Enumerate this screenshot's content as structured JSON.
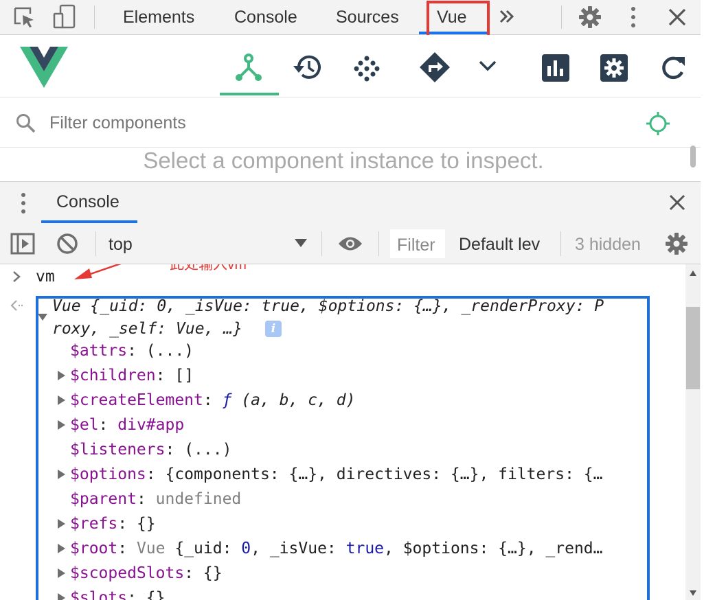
{
  "devtools": {
    "tabs": [
      "Elements",
      "Console",
      "Sources",
      "Vue"
    ],
    "active_tab": "Vue",
    "more_icon": "double-chevron-right-icon",
    "settings_icon": "gear-icon",
    "menu_icon": "vertical-dots-icon",
    "close_icon": "close-icon"
  },
  "vue_panel": {
    "logo": "vue-logo",
    "accent_color": "#42b883",
    "toolbar_icons": [
      "components-icon",
      "timeline-icon",
      "vuex-icon",
      "routing-icon",
      "chevron-down-icon",
      "performance-icon",
      "settings-icon",
      "refresh-icon"
    ],
    "filter_placeholder": "Filter components",
    "empty_message": "Select a component instance to inspect."
  },
  "drawer": {
    "tab_label": "Console",
    "context": "top",
    "filter_placeholder": "Filter",
    "levels": "Default lev",
    "hidden": "3 hidden"
  },
  "console": {
    "input": "vm",
    "annotation": "此处输入vm",
    "annotation_color": "#e53935",
    "highlight_color": "#1e6fd9",
    "summary_line1": "Vue {_uid: 0, _isVue: true, $options: {…}, _renderProxy: P",
    "summary_line2": "roxy, _self: Vue, …}",
    "info_badge": "i",
    "props": [
      {
        "name": "$attrs",
        "value": "(...)",
        "expandable": false,
        "style": "plain"
      },
      {
        "name": "$children",
        "value": "[]",
        "expandable": true,
        "style": "plain"
      },
      {
        "name": "$createElement",
        "value": "ƒ (a, b, c, d)",
        "expandable": true,
        "style": "func"
      },
      {
        "name": "$el",
        "value": "div#app",
        "expandable": true,
        "style": "node"
      },
      {
        "name": "$listeners",
        "value": "(...)",
        "expandable": false,
        "style": "plain"
      },
      {
        "name": "$options",
        "value": "{components: {…}, directives: {…}, filters: {…",
        "expandable": true,
        "style": "plain"
      },
      {
        "name": "$parent",
        "value": "undefined",
        "expandable": false,
        "style": "dim"
      },
      {
        "name": "$refs",
        "value": "{}",
        "expandable": true,
        "style": "plain"
      },
      {
        "name": "$root",
        "value": "Vue {_uid: 0, _isVue: true, $options: {…}, _rend…",
        "expandable": true,
        "style": "root"
      },
      {
        "name": "$scopedSlots",
        "value": "{}",
        "expandable": true,
        "style": "plain"
      },
      {
        "name": "$slots",
        "value": "{}",
        "expandable": true,
        "style": "plain"
      }
    ]
  }
}
